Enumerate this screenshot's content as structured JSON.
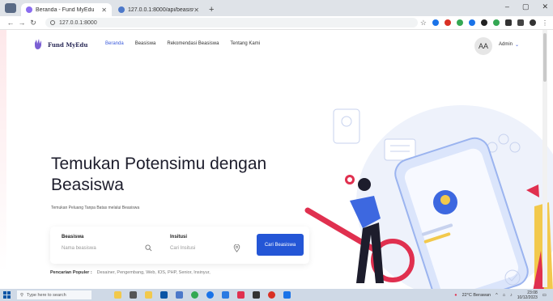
{
  "browser": {
    "tabs": [
      {
        "label": "Beranda - Fund MyEdu",
        "active": true
      },
      {
        "label": "127.0.0.1:8000/api/beasiswa",
        "active": false
      }
    ],
    "url": "127.0.0.1:8000"
  },
  "site": {
    "brand": "Fund MyEdu",
    "nav": [
      {
        "label": "Beranda",
        "active": true
      },
      {
        "label": "Beasiswa",
        "active": false
      },
      {
        "label": "Rekomendasi Beasiswa",
        "active": false
      },
      {
        "label": "Tentang Kami",
        "active": false
      }
    ],
    "avatar_initials": "AA",
    "user_name": "Admin"
  },
  "hero": {
    "title_line1": "Temukan Potensimu dengan",
    "title_line2": "Beasiswa",
    "subtitle": "Temukan Peluang Tanpa Batas melalui Beasiswa"
  },
  "search": {
    "beasiswa_label": "Beasiswa",
    "beasiswa_placeholder": "Nama beasiswa",
    "institusi_label": "Insitusi",
    "institusi_placeholder": "Cari Insitusi",
    "button": "Cari Beasiswa"
  },
  "popular": {
    "label": "Pencarian Populer :",
    "values": "Desainer, Pengembang, Web, IOS, PHP, Senior, Insinyur,"
  },
  "taskbar": {
    "search_placeholder": "Type here to search",
    "weather": "22°C Berawan",
    "time": "23:08",
    "date": "10/12/2023"
  },
  "colors": {
    "accent": "#2456d6",
    "brand_dark": "#2a2a57",
    "illustration_blue": "#3d68e0",
    "illustration_red": "#e0304f"
  }
}
